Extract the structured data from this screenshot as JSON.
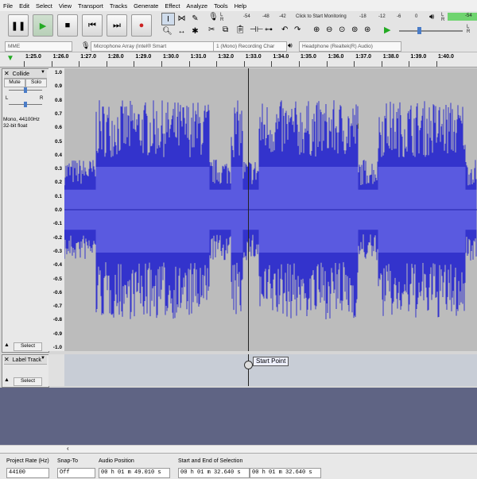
{
  "menu": [
    "File",
    "Edit",
    "Select",
    "View",
    "Transport",
    "Tracks",
    "Generate",
    "Effect",
    "Analyze",
    "Tools",
    "Help"
  ],
  "meter": {
    "rec_ticks": [
      "-54",
      "-48",
      "-42"
    ],
    "monitor_label": "Click to Start Monitoring",
    "rec_ticks2": [
      "-18",
      "-12",
      "-6",
      "0"
    ],
    "play_ticks": [
      "-54"
    ],
    "channels": [
      "L",
      "R"
    ]
  },
  "devices": {
    "host": "MME",
    "mic": "Microphone Array (Intel® Smart",
    "channels": "1 (Mono) Recording Char",
    "output": "Headphone (Realtek(R) Audio)"
  },
  "timeline": [
    "1:25.0",
    "1:26.0",
    "1:27.0",
    "1:28.0",
    "1:29.0",
    "1:30.0",
    "1:31.0",
    "1:32.0",
    "1:33.0",
    "1:34.0",
    "1:35.0",
    "1:36.0",
    "1:37.0",
    "1:38.0",
    "1:39.0",
    "1:40.0"
  ],
  "track": {
    "name": "Collide",
    "mute": "Mute",
    "solo": "Solo",
    "pan_l": "L",
    "pan_r": "R",
    "info1": "Mono, 44100Hz",
    "info2": "32-bit float",
    "select": "Select",
    "collapse_glyph": "▲"
  },
  "ruler": [
    "1.0",
    "0.9",
    "0.8",
    "0.7",
    "0.6",
    "0.5",
    "0.4",
    "0.3",
    "0.2",
    "0.1",
    "0.0",
    "-0.1",
    "-0.2",
    "-0.3",
    "-0.4",
    "-0.5",
    "-0.6",
    "-0.7",
    "-0.8",
    "-0.9",
    "-1.0"
  ],
  "label_track": {
    "name": "Label Track",
    "select": "Select",
    "label_text": "Start Point"
  },
  "selection_bar": {
    "rate_label": "Project Rate (Hz)",
    "rate_value": "44100",
    "snap_label": "Snap-To",
    "snap_value": "Off",
    "audio_pos_label": "Audio Position",
    "audio_pos_value": "00 h 01 m 49.010 s",
    "sel_label": "Start and End of Selection",
    "sel_start": "00 h 01 m 32.640 s",
    "sel_end": "00 h 01 m 32.640 s"
  },
  "colors": {
    "wave": "#3333cc",
    "wave_bg": "#bcbcbc",
    "empty_area": "#5f6484",
    "play_green": "#22aa22",
    "record_red": "#cc2222"
  }
}
